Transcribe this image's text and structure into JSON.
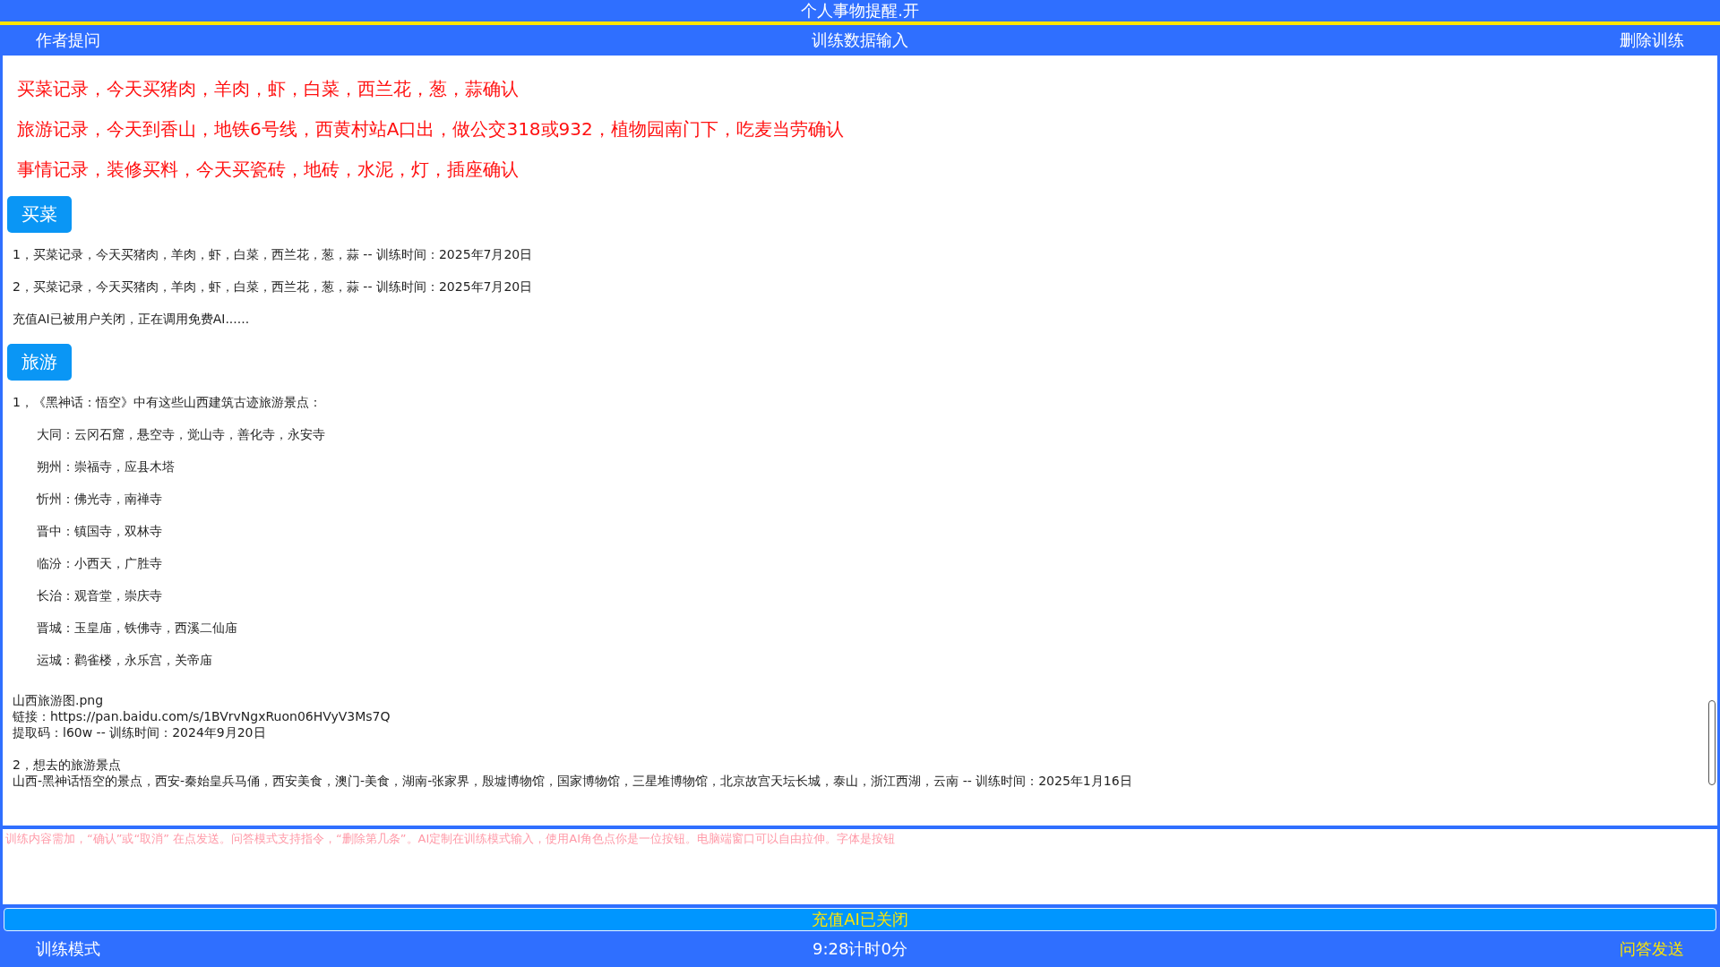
{
  "window": {
    "title": "个人事物提醒.开"
  },
  "header": {
    "left": "作者提问",
    "center": "训练数据输入",
    "right": "删除训练"
  },
  "content": [
    {
      "kind": "command",
      "text": "买菜记录，今天买猪肉，羊肉，虾，白菜，西兰花，葱，蒜确认"
    },
    {
      "kind": "command",
      "text": "旅游记录，今天到香山，地铁6号线，西黄村站A口出，做公交318或932，植物园南门下，吃麦当劳确认"
    },
    {
      "kind": "command",
      "text": "事情记录，装修买料，今天买瓷砖，地砖，水泥，灯，插座确认"
    },
    {
      "kind": "chip",
      "text": "买菜"
    },
    {
      "kind": "line",
      "text": "1，买菜记录，今天买猪肉，羊肉，虾，白菜，西兰花，葱，蒜 -- 训练时间：2025年7月20日"
    },
    {
      "kind": "line",
      "text": "2，买菜记录，今天买猪肉，羊肉，虾，白菜，西兰花，葱，蒜 -- 训练时间：2025年7月20日"
    },
    {
      "kind": "line",
      "text": "充值AI已被用户关闭，正在调用免费AI......"
    },
    {
      "kind": "chip",
      "text": "旅游"
    },
    {
      "kind": "line",
      "text": "1，《黑神话：悟空》中有这些山西建筑古迹旅游景点："
    },
    {
      "kind": "indented",
      "text": "大同：云冈石窟，悬空寺，觉山寺，善化寺，永安寺"
    },
    {
      "kind": "indented",
      "text": "朔州：崇福寺，应县木塔"
    },
    {
      "kind": "indented",
      "text": "忻州：佛光寺，南禅寺"
    },
    {
      "kind": "indented",
      "text": "晋中：镇国寺，双林寺"
    },
    {
      "kind": "indented",
      "text": "临汾：小西天，广胜寺"
    },
    {
      "kind": "indented",
      "text": "长治：观音堂，崇庆寺"
    },
    {
      "kind": "indented",
      "text": "晋城：玉皇庙，铁佛寺，西溪二仙庙"
    },
    {
      "kind": "indented",
      "text": "运城：鹳雀楼，永乐宫，关帝庙"
    },
    {
      "kind": "block",
      "lines": [
        "山西旅游图.png",
        "链接：https://pan.baidu.com/s/1BVrvNgxRuon06HVyV3Ms7Q",
        "提取码：l60w -- 训练时间：2024年9月20日"
      ]
    },
    {
      "kind": "block",
      "lines": [
        "2，想去的旅游景点",
        "山西-黑神话悟空的景点，西安-秦始皇兵马俑，西安美食，澳门-美食，湖南-张家界，殷墟博物馆，国家博物馆，三星堆博物馆，北京故宫天坛长城，泰山，浙江西湖，云南 -- 训练时间：2025年1月16日"
      ]
    }
  ],
  "input": {
    "placeholder": "训练内容需加，“确认”或“取消” 在点发送。问答模式支持指令，“删除第几条”。AI定制在训练模式输入，使用AI角色点你是一位按钮。电脑端窗口可以自由拉伸。字体是按钮"
  },
  "status_button": "充值AI已关闭",
  "footer": {
    "left": "训练模式",
    "center": "9:28计时0分",
    "right": "问答发送"
  }
}
